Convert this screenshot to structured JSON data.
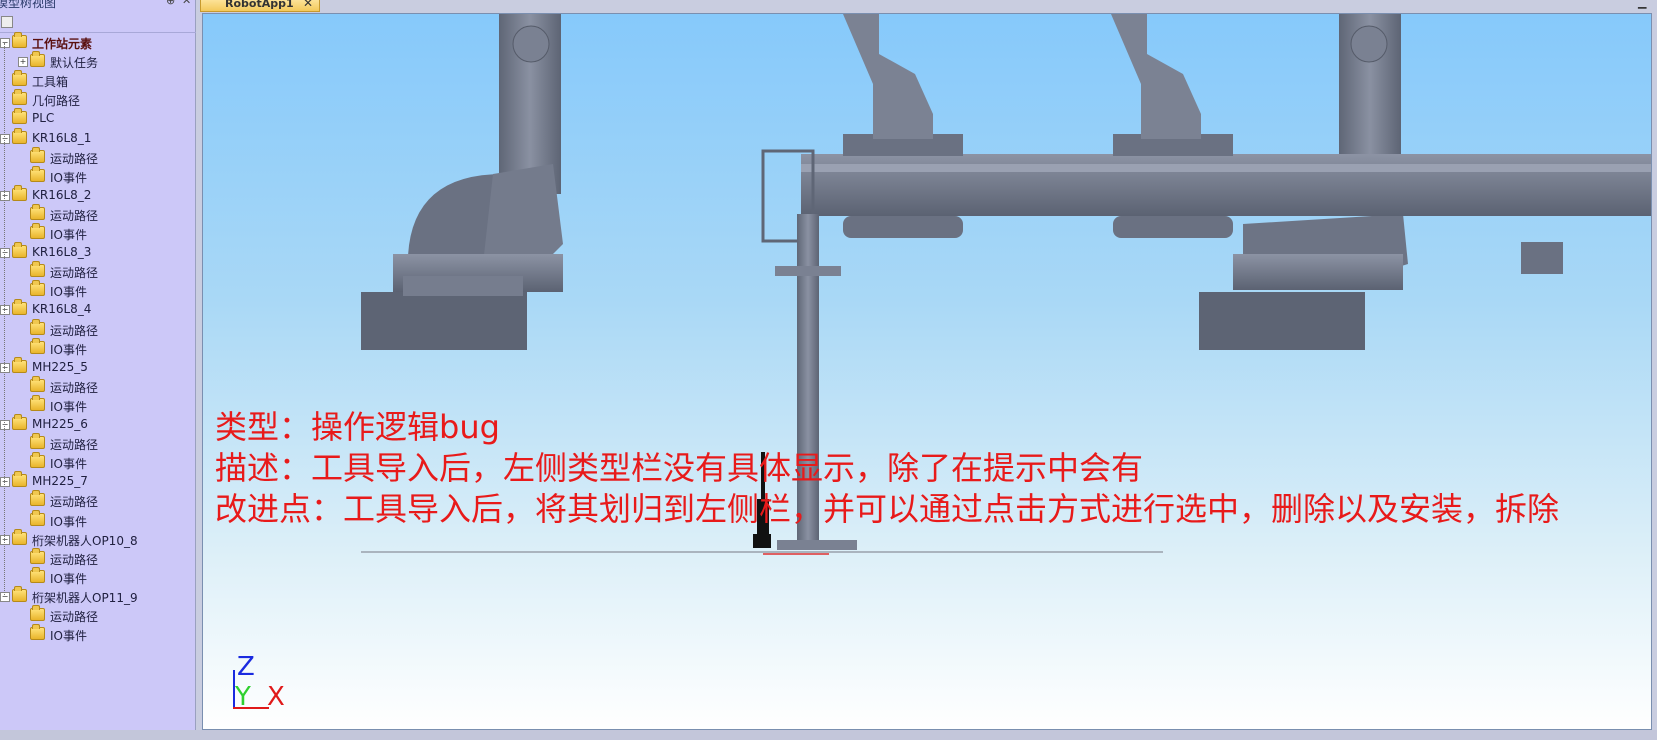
{
  "tree_panel": {
    "title": "模型树视图",
    "pin_glyph": "⊕",
    "close_glyph": "✕",
    "items": [
      {
        "label": "工作站元素",
        "level": 0,
        "bold": true,
        "expander": "−"
      },
      {
        "label": "默认任务",
        "level": 1,
        "bold": false,
        "expander": "+"
      },
      {
        "label": "工具箱",
        "level": 0,
        "bold": false,
        "expander": ""
      },
      {
        "label": "几何路径",
        "level": 0,
        "bold": false,
        "expander": ""
      },
      {
        "label": "PLC",
        "level": 0,
        "bold": false,
        "expander": ""
      },
      {
        "label": "KR16L8_1",
        "level": 0,
        "bold": false,
        "expander": "−"
      },
      {
        "label": "运动路径",
        "level": 1,
        "bold": false,
        "expander": ""
      },
      {
        "label": "IO事件",
        "level": 1,
        "bold": false,
        "expander": ""
      },
      {
        "label": "KR16L8_2",
        "level": 0,
        "bold": false,
        "expander": "−"
      },
      {
        "label": "运动路径",
        "level": 1,
        "bold": false,
        "expander": ""
      },
      {
        "label": "IO事件",
        "level": 1,
        "bold": false,
        "expander": ""
      },
      {
        "label": "KR16L8_3",
        "level": 0,
        "bold": false,
        "expander": "−"
      },
      {
        "label": "运动路径",
        "level": 1,
        "bold": false,
        "expander": ""
      },
      {
        "label": "IO事件",
        "level": 1,
        "bold": false,
        "expander": ""
      },
      {
        "label": "KR16L8_4",
        "level": 0,
        "bold": false,
        "expander": "−"
      },
      {
        "label": "运动路径",
        "level": 1,
        "bold": false,
        "expander": ""
      },
      {
        "label": "IO事件",
        "level": 1,
        "bold": false,
        "expander": ""
      },
      {
        "label": "MH225_5",
        "level": 0,
        "bold": false,
        "expander": "−"
      },
      {
        "label": "运动路径",
        "level": 1,
        "bold": false,
        "expander": ""
      },
      {
        "label": "IO事件",
        "level": 1,
        "bold": false,
        "expander": ""
      },
      {
        "label": "MH225_6",
        "level": 0,
        "bold": false,
        "expander": "−"
      },
      {
        "label": "运动路径",
        "level": 1,
        "bold": false,
        "expander": ""
      },
      {
        "label": "IO事件",
        "level": 1,
        "bold": false,
        "expander": ""
      },
      {
        "label": "MH225_7",
        "level": 0,
        "bold": false,
        "expander": "−"
      },
      {
        "label": "运动路径",
        "level": 1,
        "bold": false,
        "expander": ""
      },
      {
        "label": "IO事件",
        "level": 1,
        "bold": false,
        "expander": ""
      },
      {
        "label": "桁架机器人OP10_8",
        "level": 0,
        "bold": false,
        "expander": "−"
      },
      {
        "label": "运动路径",
        "level": 1,
        "bold": false,
        "expander": ""
      },
      {
        "label": "IO事件",
        "level": 1,
        "bold": false,
        "expander": ""
      },
      {
        "label": "桁架机器人OP11_9",
        "level": 0,
        "bold": false,
        "expander": "−"
      },
      {
        "label": "运动路径",
        "level": 1,
        "bold": false,
        "expander": ""
      },
      {
        "label": "IO事件",
        "level": 1,
        "bold": false,
        "expander": ""
      }
    ]
  },
  "doc_tab": {
    "label": "RobotApp1",
    "close_glyph": "✕"
  },
  "window": {
    "minimize_glyph": "▁"
  },
  "annotations": {
    "line1": "类型：操作逻辑bug",
    "line2": "描述：工具导入后，左侧类型栏没有具体显示，除了在提示中会有",
    "line3": "改进点：工具导入后，将其划归到左侧栏，并可以通过点击方式进行选中，删除以及安装，拆除"
  },
  "axis": {
    "z": "Z",
    "y": "Y",
    "x": "X"
  },
  "colors": {
    "annotation": "#e81a1a",
    "machine": "#6e7585",
    "tree_bg": "#ccc8f8"
  }
}
